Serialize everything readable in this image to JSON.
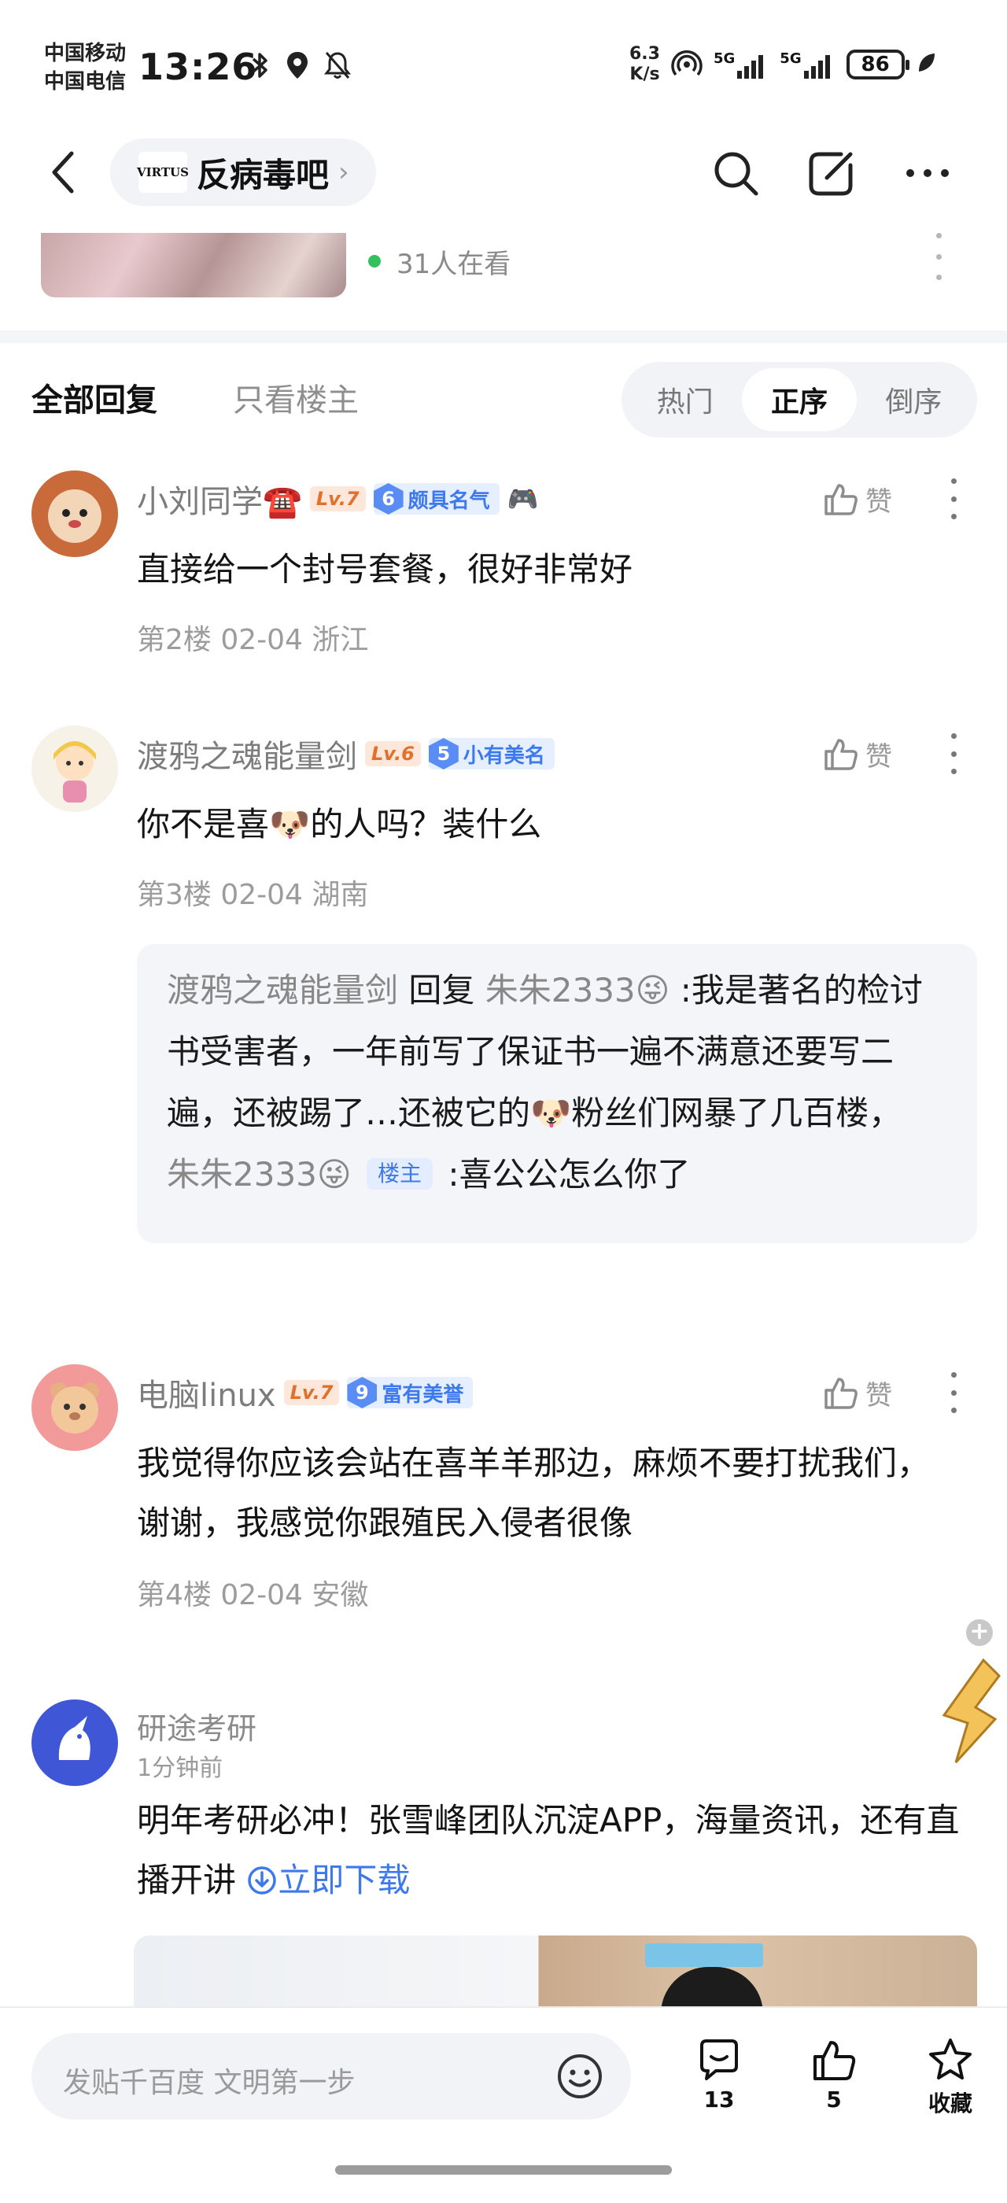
{
  "status_bar": {
    "carrier_1": "中国移动",
    "carrier_2": "中国电信",
    "time": "13:26",
    "speed_value": "6.3",
    "speed_unit": "K/s",
    "network_1": "5G",
    "network_2": "5G",
    "battery": "86"
  },
  "nav": {
    "forum_logo_text": "VIRTUS",
    "forum_name": "反病毒吧"
  },
  "live": {
    "watching": "31人在看"
  },
  "tabs": {
    "all_replies": "全部回复",
    "owner_only": "只看楼主",
    "sort_hot": "热门",
    "sort_asc": "正序",
    "sort_desc": "倒序"
  },
  "like_label": "赞",
  "posts": [
    {
      "username": "小刘同学☎️",
      "level": "Lv.7",
      "honor_num": "6",
      "honor": "颇具名气",
      "extra_badge": "🎮",
      "content": "直接给一个封号套餐，很好非常好",
      "meta": "第2楼 02-04 浙江"
    },
    {
      "username": "渡鸦之魂能量剑",
      "level": "Lv.6",
      "honor_num": "5",
      "honor": "小有美名",
      "content": "你不是喜🐶的人吗？装什么",
      "meta": "第3楼 02-04 湖南",
      "reply": {
        "author": "渡鸦之魂能量剑",
        "reply_word": "回复",
        "target": "朱朱2333😜",
        "text": ":我是著名的检讨书受害者，一年前写了保证书一遍不满意还要写二遍，还被踢了…还被它的🐶粉丝们网暴了几百楼，",
        "second_author": "朱朱2333😜",
        "owner_tag": "楼主",
        "second_text": ":喜公公怎么你了"
      }
    },
    {
      "username": "电脑linux",
      "level": "Lv.7",
      "honor_num": "9",
      "honor": "富有美誉",
      "content": "我觉得你应该会站在喜羊羊那边，麻烦不要打扰我们，谢谢，我感觉你跟殖民入侵者很像",
      "meta": "第4楼 02-04 安徽"
    }
  ],
  "ad": {
    "name": "研途考研",
    "time": "1分钟前",
    "text": "明年考研必冲！张雪峰团队沉淀APP，海量资讯，还有直播开讲",
    "link": "立即下载"
  },
  "bottom_bar": {
    "compose_placeholder": "发贴千百度 文明第一步",
    "comments_count": "13",
    "likes_count": "5",
    "favorite_label": "收藏"
  }
}
